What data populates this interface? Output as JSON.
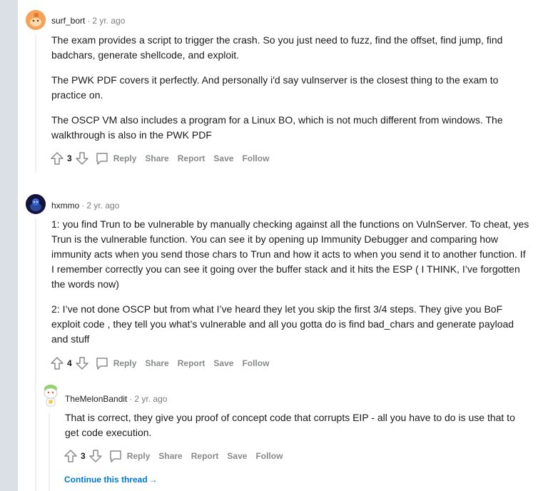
{
  "comments": [
    {
      "author": "surf_bort",
      "time": "2 yr. ago",
      "paragraphs": [
        "The exam provides a script to trigger the crash. So you just need to fuzz, find the offset, find jump, find badchars, generate shellcode, and exploit.",
        "The PWK PDF covers it perfectly. And personally i'd say vulnserver is the closest thing to the exam to practice on.",
        "The OSCP VM also includes a program for a Linux BO, which is not much different from windows. The walkthrough is also in the PWK PDF"
      ],
      "votes": "3"
    },
    {
      "author": "hxmmo",
      "time": "2 yr. ago",
      "paragraphs": [
        "1: you find Trun to be vulnerable by manually checking against all the functions on VulnServer. To cheat, yes Trun is the vulnerable function. You can see it by opening up Immunity Debugger and comparing how immunity acts when you send those chars to Trun and how it acts to when you send it to another function. If I remember correctly you can see it going over the buffer stack and it hits the ESP ( I THINK, I’ve forgotten the words now)",
        "2: I’ve not done OSCP but from what I’ve heard they let you skip the first 3/4 steps. They give you BoF exploit code , they tell you what’s vulnerable and all you gotta do is find bad_chars and generate payload and stuff"
      ],
      "votes": "4"
    },
    {
      "author": "TheMelonBandit",
      "time": "2 yr. ago",
      "paragraphs": [
        "That is correct, they give you proof of concept code that corrupts EIP - all you have to do is use that to get code execution."
      ],
      "votes": "3"
    }
  ],
  "actions": {
    "reply": "Reply",
    "share": "Share",
    "report": "Report",
    "save": "Save",
    "follow": "Follow"
  },
  "continue_thread": "Continue this thread",
  "continue_arrow": "→",
  "meta_separator": "·",
  "colors": {
    "page_bg": "#dae0e6",
    "panel_bg": "#ffffff",
    "thread_line": "#edeff1",
    "action_text": "#878a8c",
    "link": "#0079d3",
    "avatar_orange": "#f4a259"
  }
}
